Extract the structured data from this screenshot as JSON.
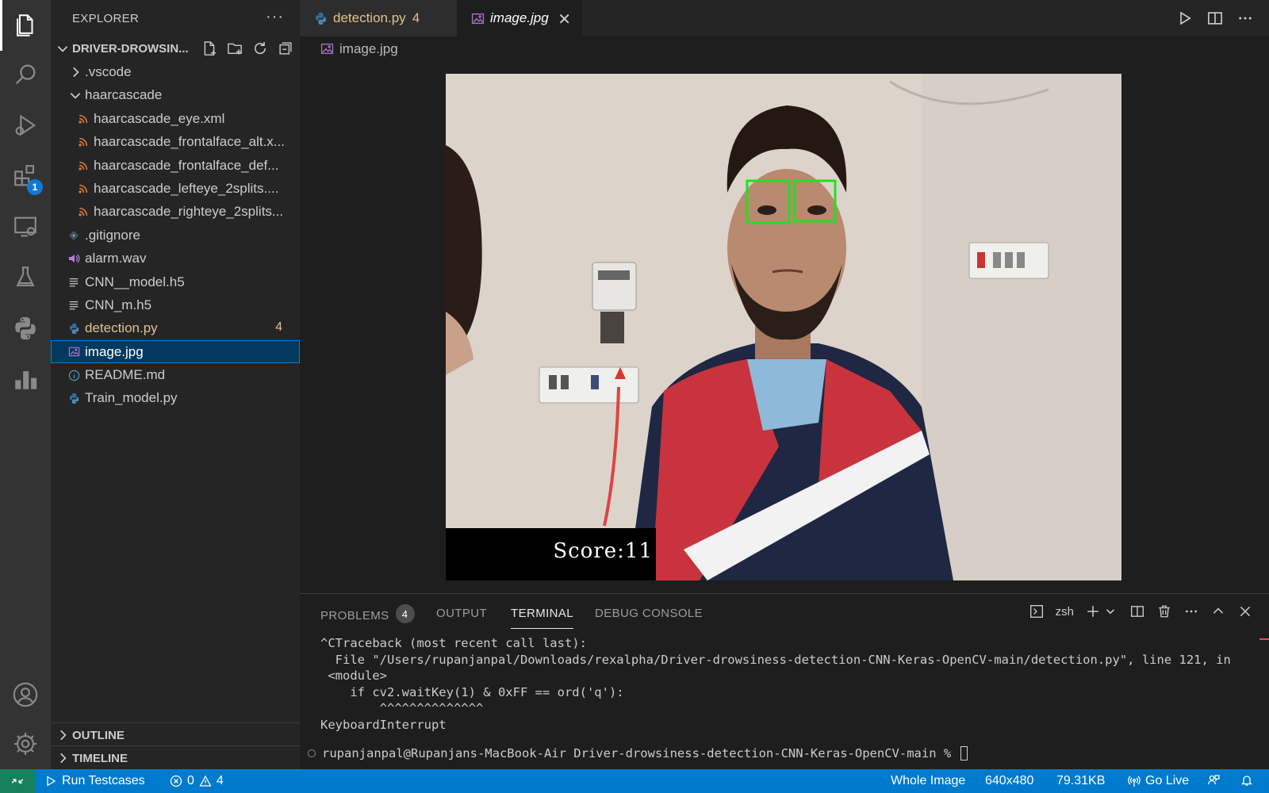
{
  "explorer": {
    "title": "EXPLORER",
    "more": "···",
    "project": "DRIVER-DROWSIN...",
    "items": [
      {
        "label": ".vscode",
        "kind": "folder",
        "expanded": false
      },
      {
        "label": "haarcascade",
        "kind": "folder",
        "expanded": true
      },
      {
        "label": "haarcascade_eye.xml",
        "kind": "xml"
      },
      {
        "label": "haarcascade_frontalface_alt.x...",
        "kind": "xml"
      },
      {
        "label": "haarcascade_frontalface_def...",
        "kind": "xml"
      },
      {
        "label": "haarcascade_lefteye_2splits....",
        "kind": "xml"
      },
      {
        "label": "haarcascade_righteye_2splits...",
        "kind": "xml"
      },
      {
        "label": ".gitignore",
        "kind": "git"
      },
      {
        "label": "alarm.wav",
        "kind": "audio"
      },
      {
        "label": "CNN__model.h5",
        "kind": "text"
      },
      {
        "label": "CNN_m.h5",
        "kind": "text"
      },
      {
        "label": "detection.py",
        "kind": "python",
        "count": "4",
        "modified": true
      },
      {
        "label": "image.jpg",
        "kind": "image",
        "selected": true
      },
      {
        "label": "README.md",
        "kind": "info"
      },
      {
        "label": "Train_model.py",
        "kind": "python"
      }
    ],
    "outline": "OUTLINE",
    "timeline": "TIMELINE"
  },
  "activity": {
    "extensions_badge": "1"
  },
  "tabs": [
    {
      "label": "detection.py",
      "count": "4"
    },
    {
      "label": "image.jpg",
      "close": "✕"
    }
  ],
  "breadcrumb": "image.jpg",
  "image": {
    "score_text": "Score:11"
  },
  "panel": {
    "tabs": [
      "PROBLEMS",
      "OUTPUT",
      "TERMINAL",
      "DEBUG CONSOLE"
    ],
    "problems_count": "4",
    "shell": "zsh",
    "terminal_lines": [
      "^CTraceback (most recent call last):",
      "  File \"/Users/rupanjanpal/Downloads/rexalpha/Driver-drowsiness-detection-CNN-Keras-OpenCV-main/detection.py\", line 121, in",
      " <module>",
      "    if cv2.waitKey(1) & 0xFF == ord('q'):",
      "        ^^^^^^^^^^^^^^",
      "KeyboardInterrupt"
    ],
    "prompt": "rupanjanpal@Rupanjans-MacBook-Air Driver-drowsiness-detection-CNN-Keras-OpenCV-main % "
  },
  "status": {
    "run_testcases": "Run Testcases",
    "errors": "0",
    "warnings": "4",
    "view": "Whole Image",
    "dimensions": "640x480",
    "size": "79.31KB",
    "golive": "Go Live"
  },
  "colors": {
    "accent": "#007acc",
    "modified": "#e2c08d",
    "selection": "#04395e",
    "eye_box": "#22e022"
  }
}
